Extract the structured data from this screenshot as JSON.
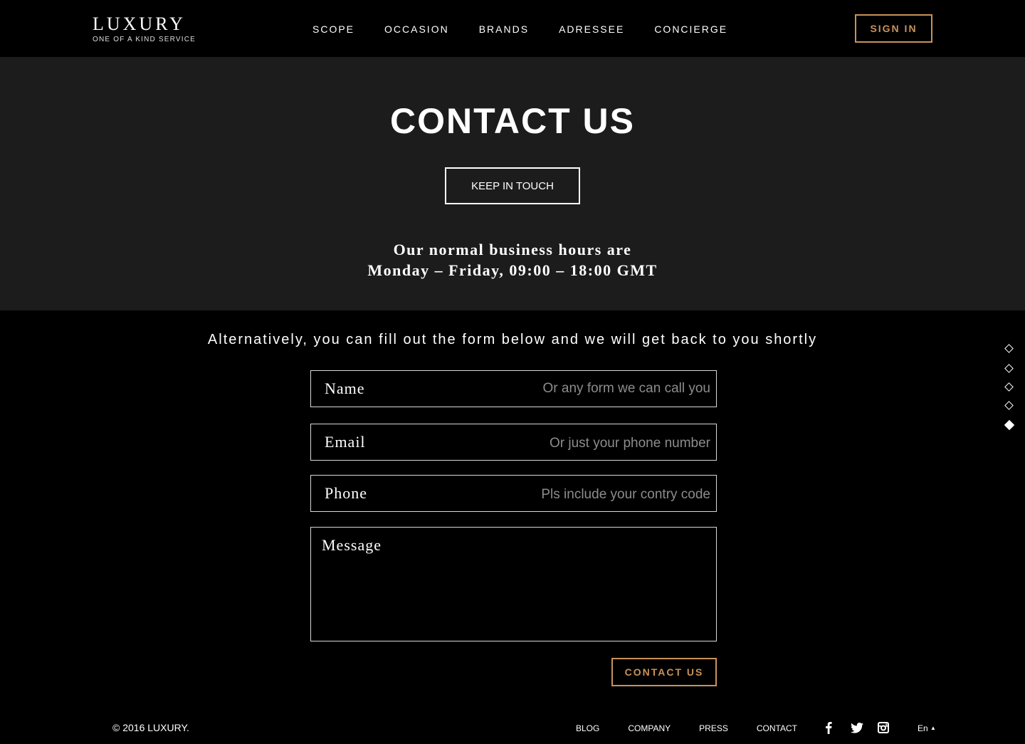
{
  "brand": {
    "title": "LUXURY",
    "tagline": "ONE OF A KIND SERVICE"
  },
  "nav": {
    "items": [
      {
        "label": "SCOPE"
      },
      {
        "label": "OCCASION"
      },
      {
        "label": "BRANDS"
      },
      {
        "label": "ADRESSEE"
      },
      {
        "label": "CONCIERGE"
      }
    ],
    "signin_label": "SIGN IN"
  },
  "hero": {
    "title": "CONTACT US",
    "keep_in_touch_label": "KEEP IN TOUCH",
    "hours_line1": "Our normal business hours are",
    "hours_line2": "Monday – Friday, 09:00 – 18:00 GMT"
  },
  "form": {
    "intro": "Alternatively, you can fill out the form below and we will get back to you shortly",
    "name": {
      "label": "Name",
      "placeholder": "Or any form we can call you"
    },
    "email": {
      "label": "Email",
      "placeholder": "Or just your phone number"
    },
    "phone": {
      "label": "Phone",
      "placeholder": "Pls include your contry code"
    },
    "message": {
      "label": "Message",
      "placeholder": ""
    },
    "submit_label": "CONTACT US"
  },
  "page_nav": {
    "count": 5,
    "active_index": 4
  },
  "footer": {
    "copyright": "© 2016 LUXURY.",
    "links": [
      {
        "label": "BLOG"
      },
      {
        "label": "COMPANY"
      },
      {
        "label": "PRESS"
      },
      {
        "label": "CONTACT"
      }
    ],
    "social": [
      "facebook-icon",
      "twitter-icon",
      "instagram-icon"
    ],
    "language": "En"
  },
  "colors": {
    "accent": "#c9925b",
    "hero_bg": "#1c1c1c",
    "page_bg": "#000000"
  }
}
